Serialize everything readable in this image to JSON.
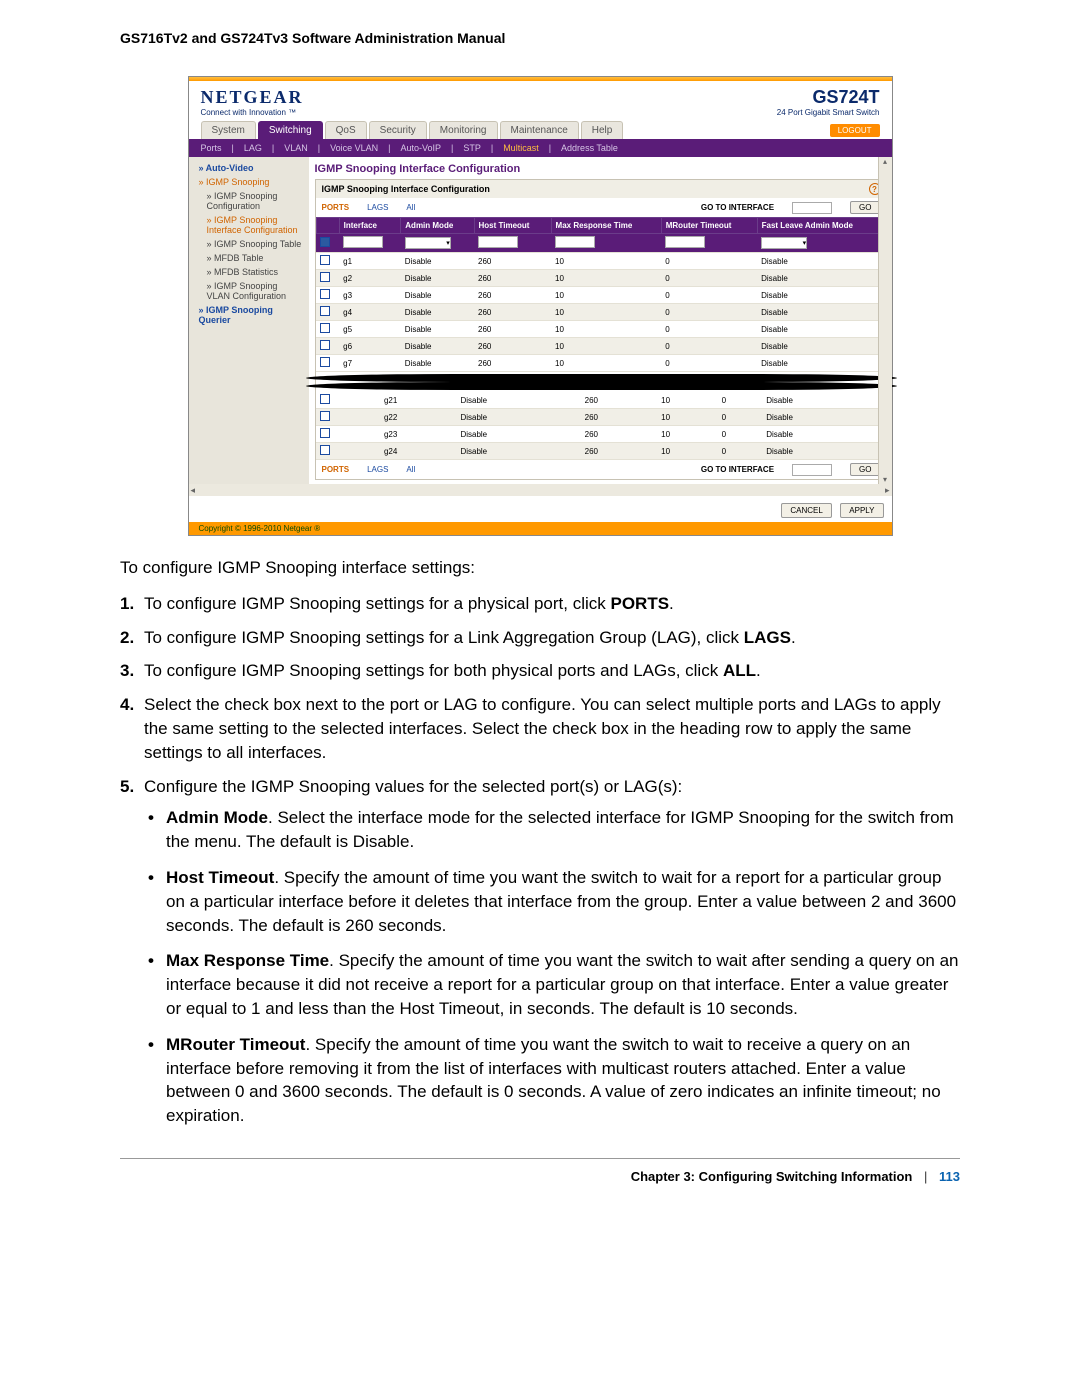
{
  "manual_title": "GS716Tv2 and GS724Tv3 Software Administration Manual",
  "brand": "NETGEAR",
  "brand_tag": "Connect with Innovation ™",
  "model": "GS724T",
  "model_sub": "24 Port Gigabit Smart Switch",
  "logout": "LOGOUT",
  "tabs": [
    "System",
    "Switching",
    "QoS",
    "Security",
    "Monitoring",
    "Maintenance",
    "Help"
  ],
  "active_tab": "Switching",
  "subtabs": [
    "Ports",
    "LAG",
    "VLAN",
    "Voice VLAN",
    "Auto-VoIP",
    "STP",
    "Multicast",
    "Address Table"
  ],
  "active_subtab": "Multicast",
  "sidebar": {
    "items": [
      {
        "label": "Auto-Video",
        "cls": "blue-link"
      },
      {
        "label": "IGMP Snooping",
        "cls": "orange"
      },
      {
        "label": "IGMP Snooping Configuration",
        "cls": "sub"
      },
      {
        "label": "IGMP Snooping Interface Configuration",
        "cls": "sub orange"
      },
      {
        "label": "IGMP Snooping Table",
        "cls": "sub"
      },
      {
        "label": "MFDB Table",
        "cls": "sub"
      },
      {
        "label": "MFDB Statistics",
        "cls": "sub"
      },
      {
        "label": "IGMP Snooping VLAN Configuration",
        "cls": "sub"
      },
      {
        "label": "IGMP Snooping Querier",
        "cls": "blue-link"
      }
    ]
  },
  "panel_title": "IGMP Snooping Interface Configuration",
  "panel_header": "IGMP Snooping Interface Configuration",
  "filters": {
    "ports": "PORTS",
    "lags": "LAGS",
    "all": "All",
    "goto": "GO TO INTERFACE",
    "go": "GO"
  },
  "columns": [
    "",
    "Interface",
    "Admin Mode",
    "Host Timeout",
    "Max Response Time",
    "MRouter Timeout",
    "Fast Leave Admin Mode"
  ],
  "rows_top": [
    {
      "if": "g1",
      "admin": "Disable",
      "ht": "260",
      "mrt": "10",
      "mr": "0",
      "fl": "Disable"
    },
    {
      "if": "g2",
      "admin": "Disable",
      "ht": "260",
      "mrt": "10",
      "mr": "0",
      "fl": "Disable"
    },
    {
      "if": "g3",
      "admin": "Disable",
      "ht": "260",
      "mrt": "10",
      "mr": "0",
      "fl": "Disable"
    },
    {
      "if": "g4",
      "admin": "Disable",
      "ht": "260",
      "mrt": "10",
      "mr": "0",
      "fl": "Disable"
    },
    {
      "if": "g5",
      "admin": "Disable",
      "ht": "260",
      "mrt": "10",
      "mr": "0",
      "fl": "Disable"
    },
    {
      "if": "g6",
      "admin": "Disable",
      "ht": "260",
      "mrt": "10",
      "mr": "0",
      "fl": "Disable"
    },
    {
      "if": "g7",
      "admin": "Disable",
      "ht": "260",
      "mrt": "10",
      "mr": "0",
      "fl": "Disable"
    }
  ],
  "rows_bottom": [
    {
      "if": "g21",
      "admin": "Disable",
      "ht": "260",
      "mrt": "10",
      "mr": "0",
      "fl": "Disable"
    },
    {
      "if": "g22",
      "admin": "Disable",
      "ht": "260",
      "mrt": "10",
      "mr": "0",
      "fl": "Disable"
    },
    {
      "if": "g23",
      "admin": "Disable",
      "ht": "260",
      "mrt": "10",
      "mr": "0",
      "fl": "Disable"
    },
    {
      "if": "g24",
      "admin": "Disable",
      "ht": "260",
      "mrt": "10",
      "mr": "0",
      "fl": "Disable"
    }
  ],
  "btn_cancel": "CANCEL",
  "btn_apply": "APPLY",
  "copyright": "Copyright © 1996-2010 Netgear ®",
  "doc": {
    "lead": "To configure IGMP Snooping interface settings:",
    "steps": [
      {
        "n": "1.",
        "txt_pre": "To configure IGMP Snooping settings for a physical port, click ",
        "bold": "PORTS",
        "txt_post": "."
      },
      {
        "n": "2.",
        "txt_pre": "To configure IGMP Snooping settings for a Link Aggregation Group (LAG), click ",
        "bold": "LAGS",
        "txt_post": "."
      },
      {
        "n": "3.",
        "txt_pre": "To configure IGMP Snooping settings for both physical ports and LAGs, click ",
        "bold": "ALL",
        "txt_post": "."
      },
      {
        "n": "4.",
        "txt": "Select the check box next to the port or LAG to configure. You can select multiple ports and LAGs to apply the same setting to the selected interfaces. Select the check box in the heading row to apply the same settings to all interfaces."
      },
      {
        "n": "5.",
        "txt": "Configure the IGMP Snooping values for the selected port(s) or LAG(s):"
      }
    ],
    "bullets": [
      {
        "b": "Admin Mode",
        "t": ". Select the interface mode for the selected interface for IGMP Snooping for the switch from the menu. The default is Disable."
      },
      {
        "b": "Host Timeout",
        "t": ". Specify the amount of time you want the switch to wait for a report for a particular group on a particular interface before it deletes that interface from the group. Enter a value between 2 and 3600 seconds. The default is 260 seconds."
      },
      {
        "b": "Max Response Time",
        "t": ". Specify the amount of time you want the switch to wait after sending a query on an interface because it did not receive a report for a particular group on that interface. Enter a value greater or equal to 1 and less than the Host Timeout, in seconds. The default is 10 seconds."
      },
      {
        "b": "MRouter Timeout",
        "t": ". Specify the amount of time you want the switch to wait to receive a query on an interface before removing it from the list of interfaces with multicast routers attached. Enter a value between 0 and 3600 seconds. The default is 0 seconds. A value of zero indicates an infinite timeout; no expiration."
      }
    ]
  },
  "footer": {
    "chapter": "Chapter 3:  Configuring Switching Information",
    "sep": "|",
    "page": "113"
  }
}
